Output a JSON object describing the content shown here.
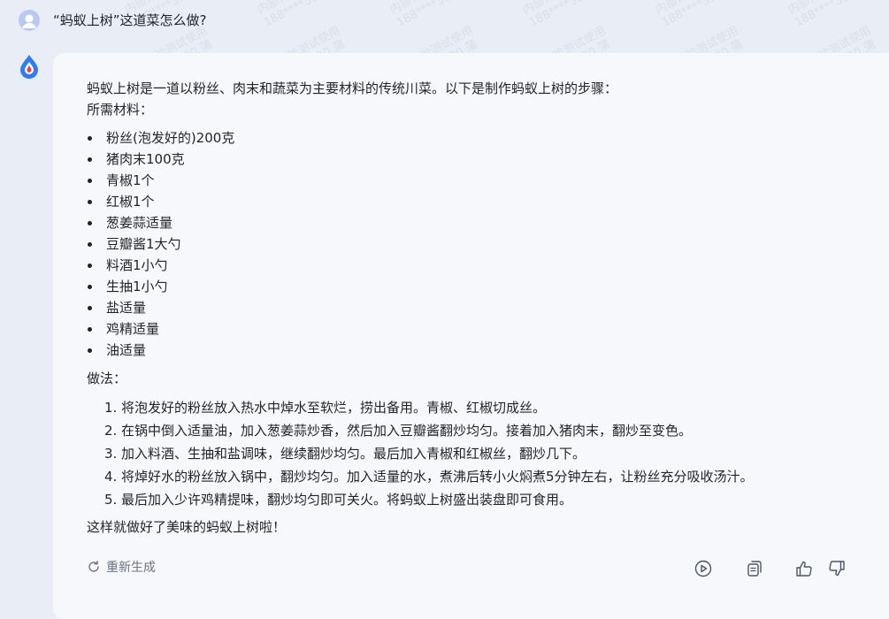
{
  "question": "“蚂蚁上树”这道菜怎么做?",
  "answer": {
    "intro": "蚂蚁上树是一道以粉丝、肉末和蔬菜为主要材料的传统川菜。以下是制作蚂蚁上树的步骤：",
    "ingredients_title": "所需材料：",
    "ingredients": [
      "粉丝(泡发好的)200克",
      "猪肉末100克",
      "青椒1个",
      "红椒1个",
      "葱姜蒜适量",
      "豆瓣酱1大勺",
      "料酒1小勺",
      "生抽1小勺",
      "盐适量",
      "鸡精适量",
      "油适量"
    ],
    "method_title": "做法：",
    "steps": [
      {
        "num": "1.",
        "text": "将泡发好的粉丝放入热水中焯水至软烂，捞出备用。青椒、红椒切成丝。"
      },
      {
        "num": "2.",
        "text": "在锅中倒入适量油，加入葱姜蒜炒香，然后加入豆瓣酱翻炒均匀。接着加入猪肉末，翻炒至变色。"
      },
      {
        "num": "3.",
        "text": "加入料酒、生抽和盐调味，继续翻炒均匀。最后加入青椒和红椒丝，翻炒几下。"
      },
      {
        "num": "4.",
        "text": "将焯好水的粉丝放入锅中，翻炒均匀。加入适量的水，煮沸后转小火焖煮5分钟左右，让粉丝充分吸收汤汁。"
      },
      {
        "num": "5.",
        "text": "最后加入少许鸡精提味，翻炒均匀即可关火。将蚂蚁上树盛出装盘即可食用。"
      }
    ],
    "closing": "这样就做好了美味的蚂蚁上树啦！"
  },
  "regenerate_label": "重新生成",
  "watermark": {
    "line1": "内部体验测试使用",
    "line2": "188****3920 蒲"
  },
  "colors": {
    "background": "#e9edf6",
    "card": "#f6f8fc",
    "text": "#1f2329",
    "muted": "#6b7280",
    "brand_blue": "#2f7cf6",
    "brand_red": "#e8413c"
  }
}
